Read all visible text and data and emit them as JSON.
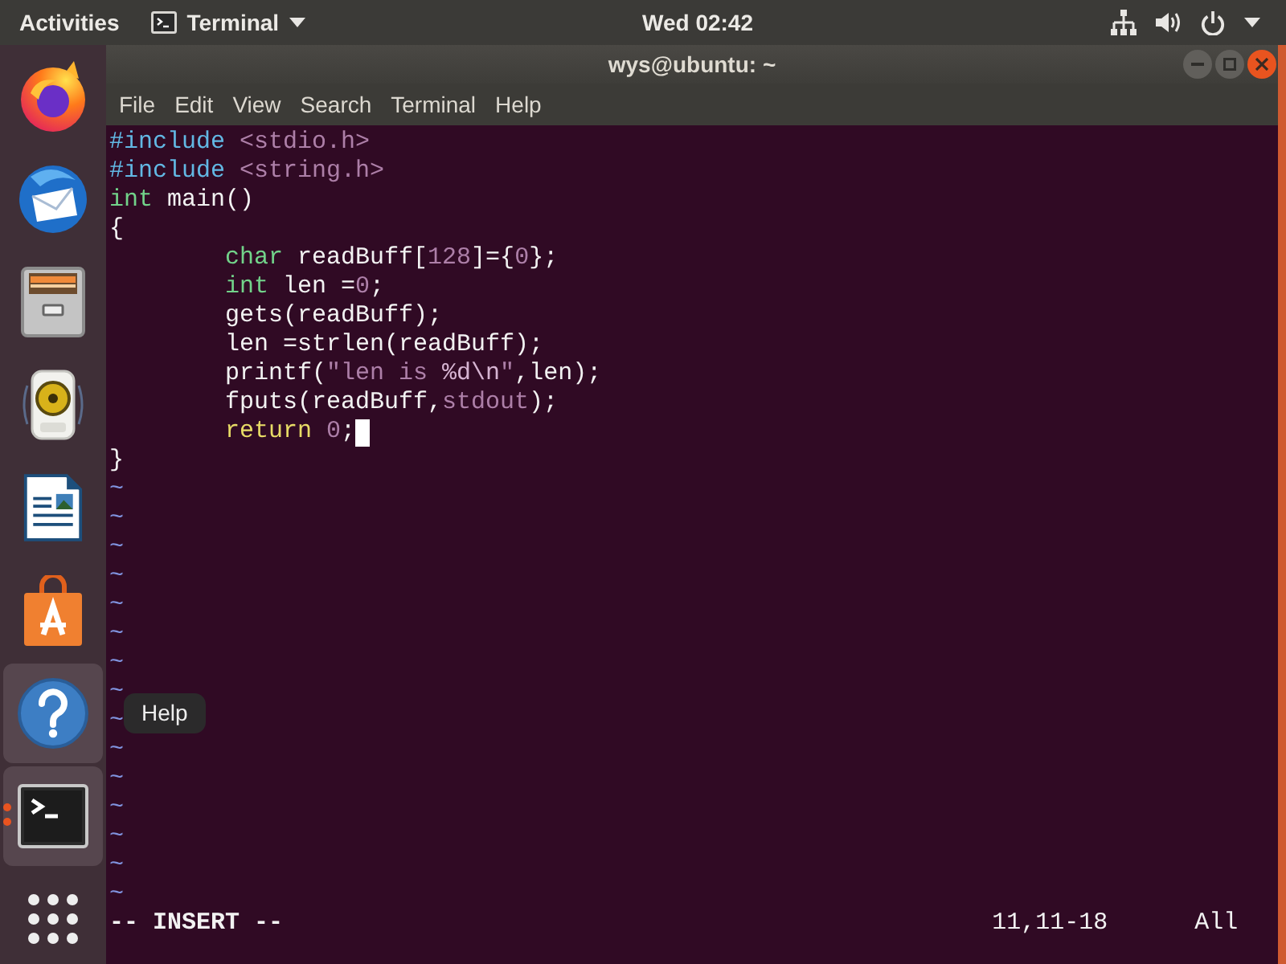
{
  "top_bar": {
    "activities": "Activities",
    "app_menu": "Terminal",
    "clock": "Wed 02:42"
  },
  "dock": {
    "items": [
      {
        "kind": "browser",
        "running": false,
        "highlighted": false
      },
      {
        "kind": "mail",
        "running": false,
        "highlighted": false
      },
      {
        "kind": "files",
        "running": false,
        "highlighted": false
      },
      {
        "kind": "music",
        "running": false,
        "highlighted": false
      },
      {
        "kind": "writer",
        "running": false,
        "highlighted": false
      },
      {
        "kind": "software",
        "running": false,
        "highlighted": false
      },
      {
        "kind": "help",
        "running": false,
        "highlighted": true,
        "tooltip": "Help"
      },
      {
        "kind": "terminal",
        "running": true,
        "highlighted": true
      },
      {
        "kind": "apps",
        "running": false,
        "highlighted": false
      }
    ]
  },
  "window": {
    "title": "wys@ubuntu: ~",
    "menu": [
      "File",
      "Edit",
      "View",
      "Search",
      "Terminal",
      "Help"
    ],
    "editor": {
      "lines": [
        {
          "segments": [
            {
              "text": "#include",
              "kind": "preproc"
            },
            {
              "text": " <stdio.h>",
              "kind": "string"
            }
          ],
          "indented": false,
          "cursor": false
        },
        {
          "segments": [
            {
              "text": "#include",
              "kind": "preproc"
            },
            {
              "text": " <string.h>",
              "kind": "string"
            }
          ],
          "indented": false,
          "cursor": false
        },
        {
          "segments": [
            {
              "text": "int",
              "kind": "type"
            },
            {
              "text": " main()",
              "kind": "plain"
            }
          ],
          "indented": false,
          "cursor": false
        },
        {
          "segments": [
            {
              "text": "{",
              "kind": "plain"
            }
          ],
          "indented": false,
          "cursor": false
        },
        {
          "segments": [
            {
              "text": "char",
              "kind": "type"
            },
            {
              "text": " readBuff[",
              "kind": "plain"
            },
            {
              "text": "128",
              "kind": "number"
            },
            {
              "text": "]={",
              "kind": "plain"
            },
            {
              "text": "0",
              "kind": "number"
            },
            {
              "text": "};",
              "kind": "plain"
            }
          ],
          "indented": true,
          "cursor": false
        },
        {
          "segments": [
            {
              "text": "int",
              "kind": "type"
            },
            {
              "text": " len =",
              "kind": "plain"
            },
            {
              "text": "0",
              "kind": "number"
            },
            {
              "text": ";",
              "kind": "plain"
            }
          ],
          "indented": true,
          "cursor": false
        },
        {
          "segments": [
            {
              "text": "gets(readBuff);",
              "kind": "plain"
            }
          ],
          "indented": true,
          "cursor": false
        },
        {
          "segments": [
            {
              "text": "len =strlen(readBuff);",
              "kind": "plain"
            }
          ],
          "indented": true,
          "cursor": false
        },
        {
          "segments": [
            {
              "text": "printf(",
              "kind": "plain"
            },
            {
              "text": "\"len is ",
              "kind": "string"
            },
            {
              "text": "%d\\n",
              "kind": "special"
            },
            {
              "text": "\"",
              "kind": "string"
            },
            {
              "text": ",len);",
              "kind": "plain"
            }
          ],
          "indented": true,
          "cursor": false
        },
        {
          "segments": [
            {
              "text": "fputs(readBuff,",
              "kind": "plain"
            },
            {
              "text": "stdout",
              "kind": "constant"
            },
            {
              "text": ");",
              "kind": "plain"
            }
          ],
          "indented": true,
          "cursor": false
        },
        {
          "segments": [
            {
              "text": "return",
              "kind": "statement"
            },
            {
              "text": " 0",
              "kind": "number"
            },
            {
              "text": ";",
              "kind": "plain"
            }
          ],
          "indented": true,
          "cursor": true
        },
        {
          "segments": [
            {
              "text": "}",
              "kind": "plain"
            }
          ],
          "indented": false,
          "cursor": false
        }
      ],
      "empty_lines": [
        "~",
        "~",
        "~",
        "~",
        "~",
        "~",
        "~",
        "~",
        "~",
        "~",
        "~",
        "~",
        "~",
        "~",
        "~"
      ],
      "status": {
        "mode": "-- INSERT --",
        "ruler": "11,11-18",
        "scroll": "All"
      }
    }
  }
}
